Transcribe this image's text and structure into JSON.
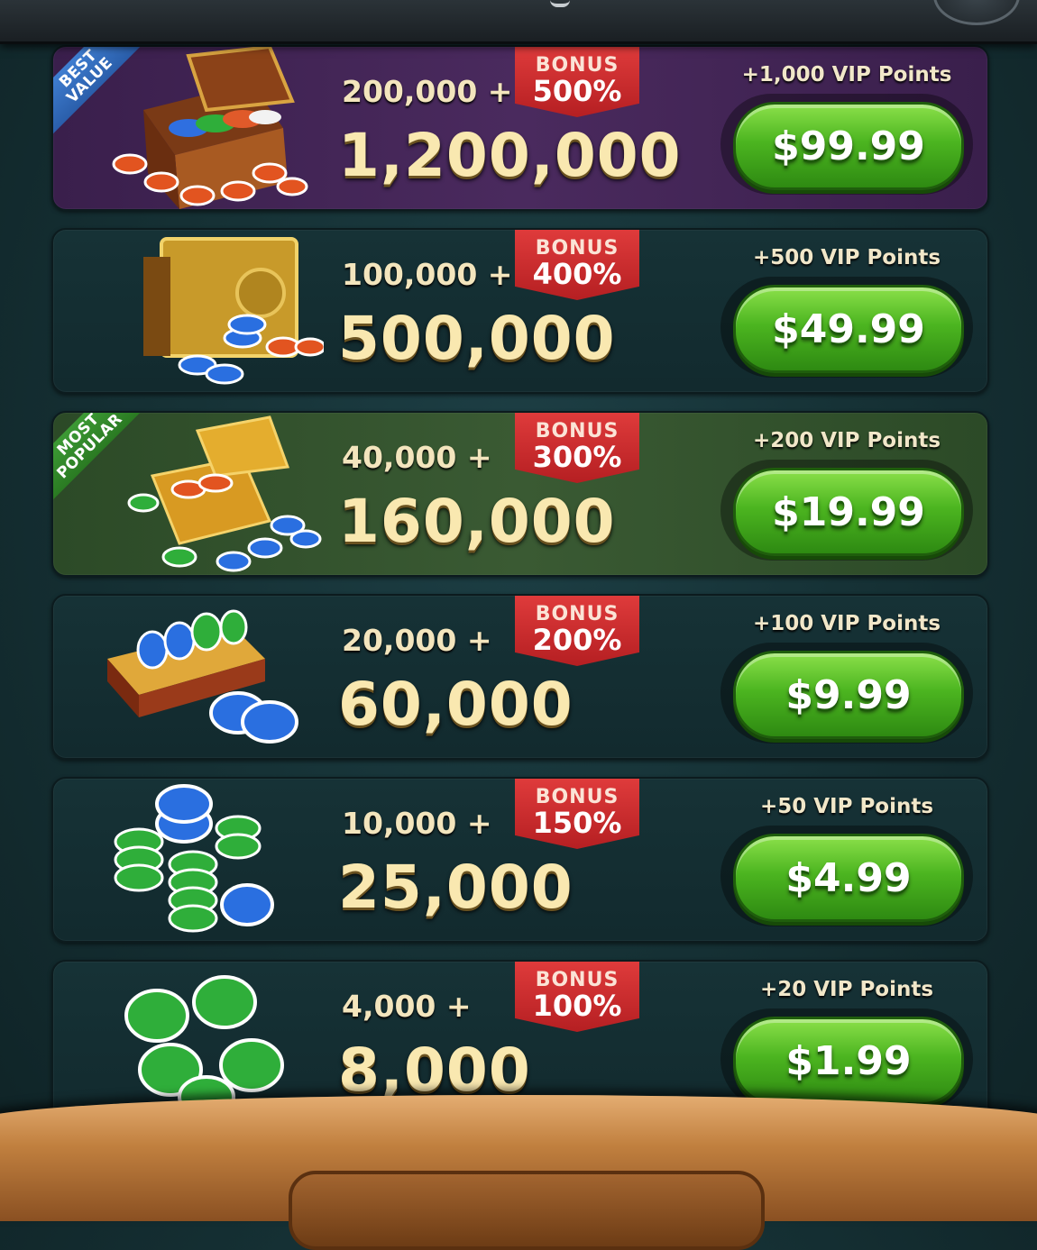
{
  "packages": [
    {
      "base": "200,000 +",
      "bonus_label": "BONUS",
      "bonus_pct": "500%",
      "total": "1,200,000",
      "vip": "+1,000 VIP Points",
      "price": "$99.99",
      "tag_line1": "BEST",
      "tag_line2": "VALUE",
      "theme": "best"
    },
    {
      "base": "100,000 +",
      "bonus_label": "BONUS",
      "bonus_pct": "400%",
      "total": "500,000",
      "vip": "+500 VIP Points",
      "price": "$49.99",
      "theme": "normal"
    },
    {
      "base": "40,000 +",
      "bonus_label": "BONUS",
      "bonus_pct": "300%",
      "total": "160,000",
      "vip": "+200 VIP Points",
      "price": "$19.99",
      "tag_line1": "MOST",
      "tag_line2": "POPULAR",
      "theme": "popular"
    },
    {
      "base": "20,000 +",
      "bonus_label": "BONUS",
      "bonus_pct": "200%",
      "total": "60,000",
      "vip": "+100 VIP Points",
      "price": "$9.99",
      "theme": "normal"
    },
    {
      "base": "10,000 +",
      "bonus_label": "BONUS",
      "bonus_pct": "150%",
      "total": "25,000",
      "vip": "+50 VIP Points",
      "price": "$4.99",
      "theme": "normal"
    },
    {
      "base": "4,000 +",
      "bonus_label": "BONUS",
      "bonus_pct": "100%",
      "total": "8,000",
      "vip": "+20 VIP Points",
      "price": "$1.99",
      "theme": "normal"
    }
  ],
  "icons": [
    "chest-of-chips-icon",
    "safe-with-chips-icon",
    "open-box-with-chips-icon",
    "tray-of-chips-icon",
    "chip-stacks-icon",
    "green-chips-icon"
  ],
  "colors": {
    "price_button": "#4cb520",
    "bonus_ribbon": "#c92a2d",
    "best_value_tag": "#2a5eaa",
    "most_popular_tag": "#2a7a22"
  }
}
